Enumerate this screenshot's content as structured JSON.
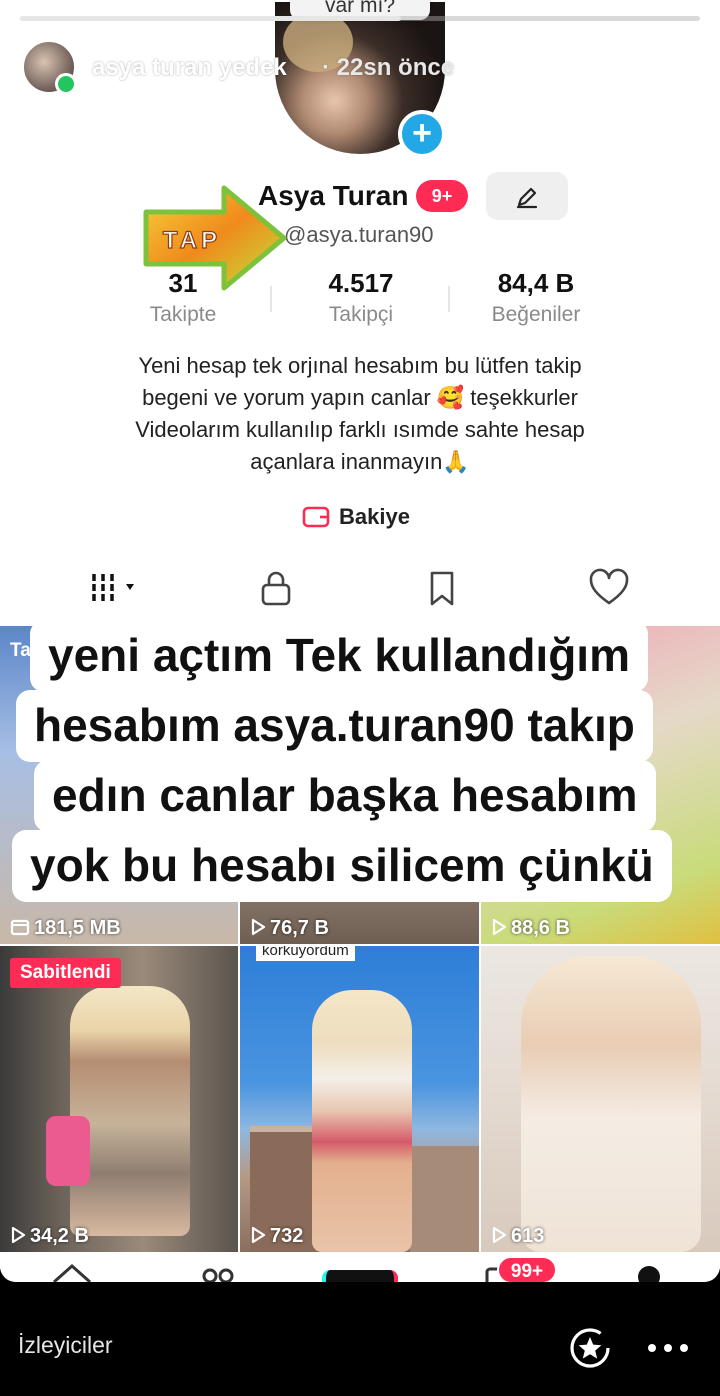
{
  "story": {
    "username": "asya turan yedek",
    "time_ago": "· 22sn önce",
    "progress": 0.56,
    "viewers_label": "İzleyiciler"
  },
  "profile": {
    "previous_snippet": "var mı?",
    "display_name": "Asya Turan",
    "name_badge": "9+",
    "handle": "@asya.turan90",
    "sticker_text": "TAP",
    "stats": [
      {
        "value": "31",
        "label": "Takipte"
      },
      {
        "value": "4.517",
        "label": "Takipçi"
      },
      {
        "value": "84,4 B",
        "label": "Beğeniler"
      }
    ],
    "bio_lines": [
      "Yeni hesap tek orjınal hesabım bu lütfen takip",
      "begeni ve yorum yapın canlar 🥰 teşekkurler",
      "Videolarım kullanılıp farklı ısımde sahte hesap",
      "açanlara inanmayın🙏"
    ],
    "balance_label": "Bakiye"
  },
  "tabs": [
    "videos-grid-icon",
    "lock-icon",
    "bookmark-icon",
    "heart-icon"
  ],
  "caption_lines": [
    "yeni açtım Tek kullandığım",
    "hesabım asya.turan90 takıp",
    "edın canlar başka hesabım",
    "yok bu hesabı silicem çünkü"
  ],
  "grid": {
    "row1": [
      {
        "count": "181,5 MB",
        "corner_text": "Ta"
      },
      {
        "count": "76,7 B"
      },
      {
        "count": "88,6 B"
      }
    ],
    "row2": [
      {
        "count": "34,2 B",
        "pinned_label": "Sabitlendi"
      },
      {
        "count": "732",
        "overlay_text": "korkuyordum"
      },
      {
        "count": "613"
      }
    ]
  },
  "bottom_nav": {
    "badge": "99+"
  },
  "colors": {
    "accent": "#fe2c55",
    "follow_plus": "#22a8e6",
    "online_dot": "#22c55e"
  }
}
